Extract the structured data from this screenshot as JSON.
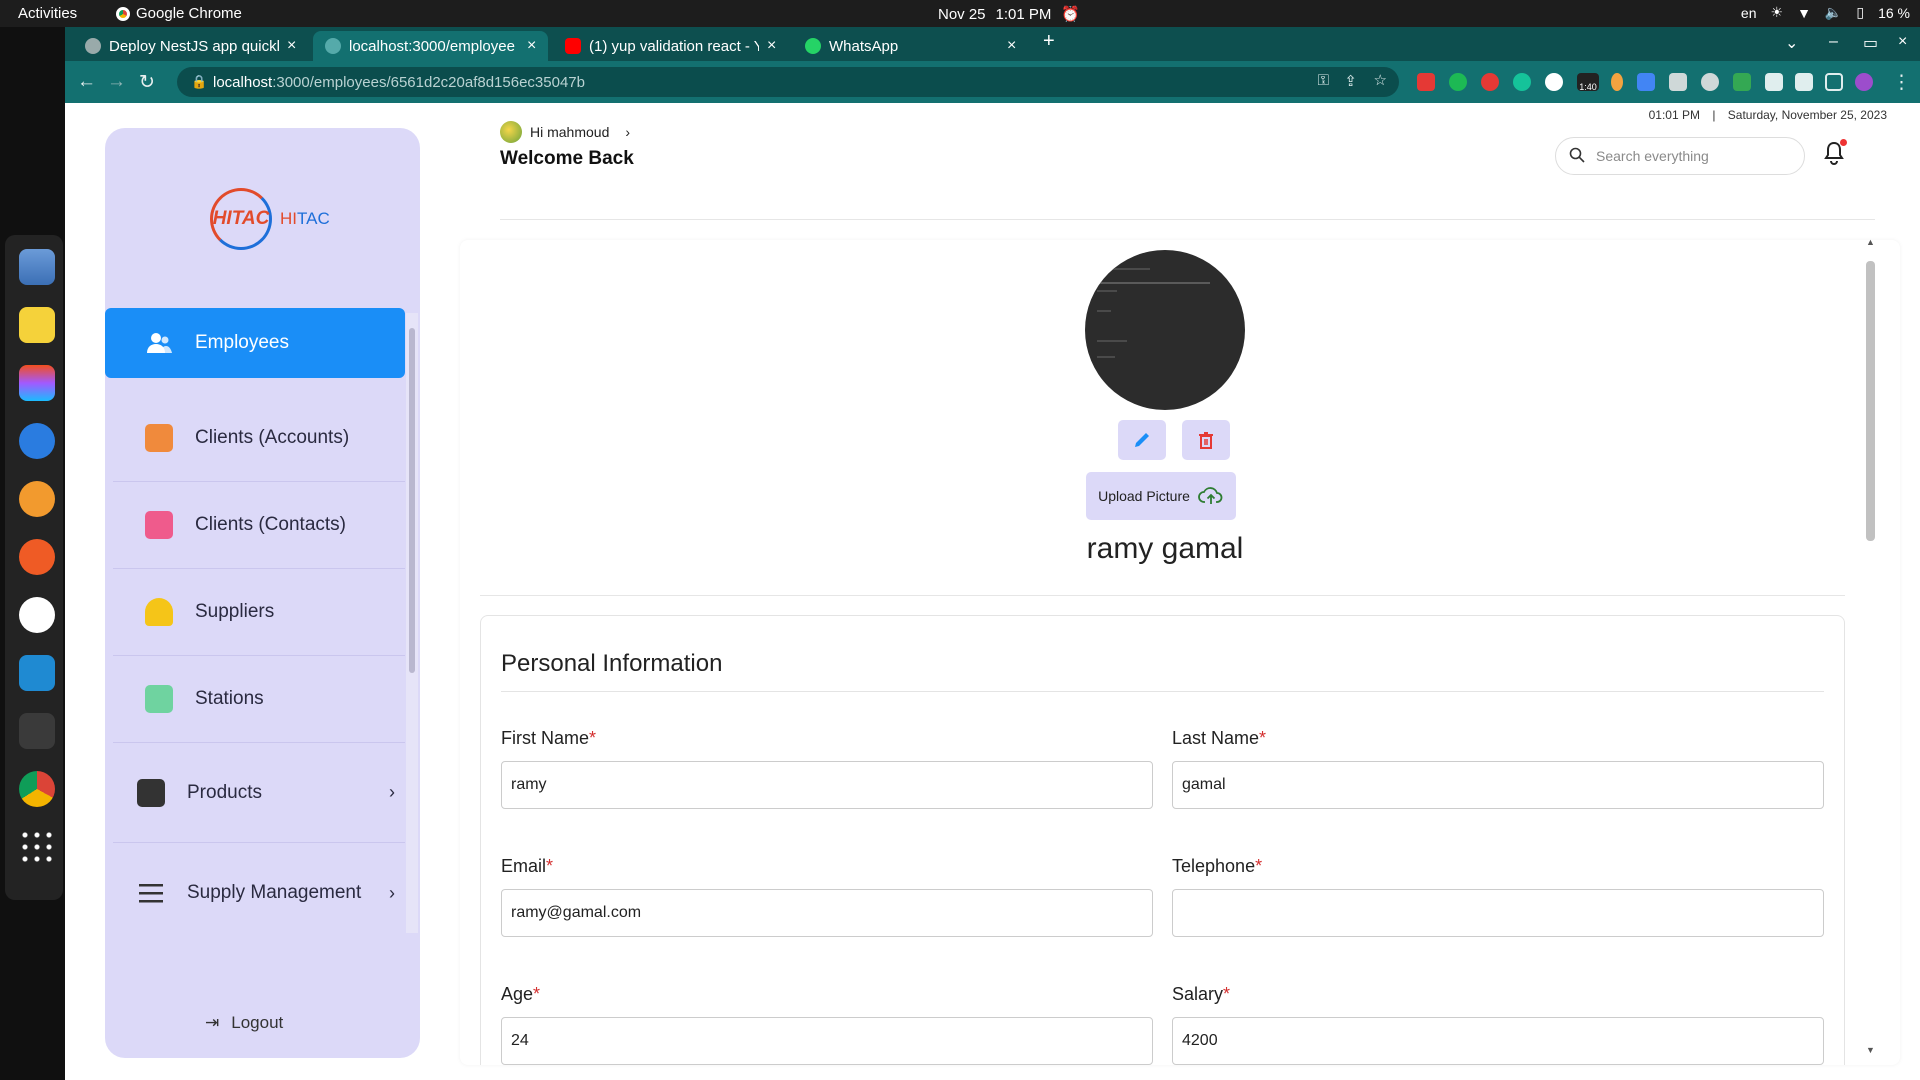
{
  "system": {
    "activities": "Activities",
    "app_name": "Google Chrome",
    "date": "Nov 25",
    "time": "1:01 PM",
    "lang": "en",
    "battery": "16 %"
  },
  "browser": {
    "tabs": [
      {
        "title": "Deploy NestJS app quickl",
        "favicon_color": "#9aa"
      },
      {
        "title": "localhost:3000/employee",
        "favicon_color": "#5aa"
      },
      {
        "title": "(1) yup validation react - Y",
        "favicon_color": "#f00"
      },
      {
        "title": "WhatsApp",
        "favicon_color": "#25d366"
      }
    ],
    "url_host": "localhost",
    "url_path": ":3000/employees/6561d2c20af8d156ec35047b",
    "ext_badge": "1:40"
  },
  "sidebar": {
    "logo_mark": "HITAC",
    "logo_hi": "HI",
    "logo_tac": "TAC",
    "items": [
      {
        "label": "Employees",
        "icon": "employees-icon",
        "color": "#ffffff"
      },
      {
        "label": "Clients (Accounts)",
        "icon": "building-icon",
        "color": "#f08a3c"
      },
      {
        "label": "Clients (Contacts)",
        "icon": "contact-book-icon",
        "color": "#ef5b8c"
      },
      {
        "label": "Suppliers",
        "icon": "supplier-icon",
        "color": "#f5c518"
      },
      {
        "label": "Stations",
        "icon": "station-icon",
        "color": "#6fd3a0"
      },
      {
        "label": "Products",
        "icon": "box-icon",
        "color": "#333333"
      },
      {
        "label": "Supply Management",
        "icon": "list-icon",
        "color": "#333333"
      }
    ],
    "logout": "Logout"
  },
  "header": {
    "greeting": "Hi mahmoud",
    "welcome": "Welcome Back",
    "time": "01:01 PM",
    "separator": "|",
    "date": "Saturday, November 25, 2023",
    "search_placeholder": "Search everything"
  },
  "profile": {
    "upload_label": "Upload Picture",
    "full_name": "ramy gamal"
  },
  "personal_info": {
    "title": "Personal Information",
    "required_mark": "*",
    "first_name_label": "First Name",
    "first_name": "ramy",
    "last_name_label": "Last Name",
    "last_name": "gamal",
    "email_label": "Email",
    "email": "ramy@gamal.com",
    "telephone_label": "Telephone",
    "telephone": "",
    "age_label": "Age",
    "age": "24",
    "salary_label": "Salary",
    "salary": "4200"
  },
  "colors": {
    "accent": "#1a8ef7",
    "sidebar_bg": "#dcd9f8",
    "required": "#d32f2f",
    "chrome_theme": "#137070"
  }
}
